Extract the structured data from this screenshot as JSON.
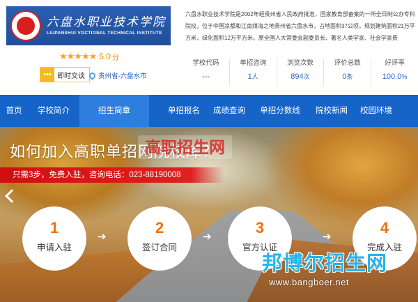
{
  "school": {
    "logo_cn": "六盘水职业技术学院",
    "logo_en": "LIUPANSHUI VOCTIONAL TECHNICAL INSTITUTE",
    "rating_stars": 5,
    "score": "5.0",
    "score_unit": "分",
    "chat_label": "即时交谈",
    "location": "贵州省-六盘水市",
    "intro": "六盘水职业技术学院是2002年经贵州省人民政府批准，国家教育部备案的一所全日制公办专科院校，位于中国凉都和江南煤海之地贵州省六盘水市，占地面积37公顷，规划建筑面积21万平方米，绿化面积12万平方米。原全国人大常委会副委员长、著名人类学家、社会学家费"
  },
  "stats": [
    {
      "label": "学校代码",
      "value": "---",
      "unit": ""
    },
    {
      "label": "单招咨询",
      "value": "1",
      "unit": "人"
    },
    {
      "label": "浏览次数",
      "value": "894",
      "unit": "次"
    },
    {
      "label": "评价总数",
      "value": "0",
      "unit": "条"
    },
    {
      "label": "好评率",
      "value": "100.0",
      "unit": "%"
    }
  ],
  "nav": [
    {
      "label": "首页",
      "active": false
    },
    {
      "label": "学校简介",
      "active": false
    },
    {
      "label": "招生简章",
      "active": true
    },
    {
      "label": "单招报名",
      "active": false
    },
    {
      "label": "成绩查询",
      "active": false
    },
    {
      "label": "单招分数线",
      "active": false
    },
    {
      "label": "院校新闻",
      "active": false
    },
    {
      "label": "校园环境",
      "active": false
    }
  ],
  "hero": {
    "title": "如何加入高职单招网院校库？",
    "subtitle": "只需3步，免费入驻，咨询电话：023-88190008",
    "watermark_top": "高职招生网",
    "steps": [
      {
        "num": "1",
        "label": "申请入驻"
      },
      {
        "num": "2",
        "label": "签订合同"
      },
      {
        "num": "3",
        "label": "官方认证"
      },
      {
        "num": "4",
        "label": "完成入驻"
      }
    ],
    "watermark_name": "邦博尔招生网",
    "watermark_url": "www.bangboer.net"
  },
  "colors": {
    "nav_bg": "#1664c8",
    "nav_active": "#2e7ee0",
    "accent_orange": "#f07010",
    "banner_red": "#d01010",
    "stat_blue": "#2a6cc4"
  }
}
